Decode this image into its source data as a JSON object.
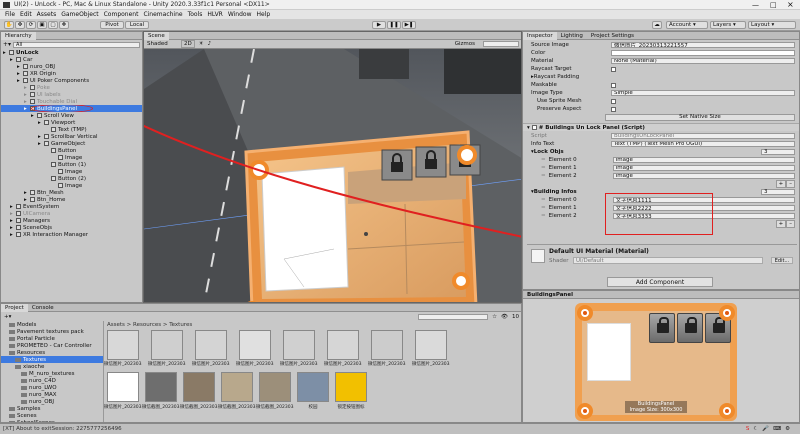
{
  "window": {
    "title": "UI(2) - UnLock - PC, Mac & Linux Standalone - Unity 2020.3.33f1c1 Personal <DX11>"
  },
  "menu": [
    "File",
    "Edit",
    "Assets",
    "GameObject",
    "Component",
    "Cinemachine",
    "Tools",
    "HLVR",
    "Window",
    "Help"
  ],
  "toolbar": {
    "pivot": "Pivot",
    "local": "Local",
    "account": "Account",
    "layers": "Layers",
    "layout": "Layout"
  },
  "hierarchy": {
    "tab": "Hierarchy",
    "search": "All",
    "items": [
      {
        "label": "UnLock",
        "indent": 0,
        "bold": true
      },
      {
        "label": "Car",
        "indent": 1
      },
      {
        "label": "nuro_OBJ",
        "indent": 2
      },
      {
        "label": "XR Origin",
        "indent": 2
      },
      {
        "label": "UI Poker Components",
        "indent": 2
      },
      {
        "label": "Poke",
        "indent": 3,
        "dim": true
      },
      {
        "label": "UI labels",
        "indent": 3,
        "dim": true
      },
      {
        "label": "Touchable Dial",
        "indent": 3,
        "dim": true
      },
      {
        "label": "BuildingsPanel",
        "indent": 3,
        "selected": true
      },
      {
        "label": "Scroll View",
        "indent": 4
      },
      {
        "label": "Viewport",
        "indent": 5
      },
      {
        "label": "Text (TMP)",
        "indent": 6
      },
      {
        "label": "Scrollbar Vertical",
        "indent": 5
      },
      {
        "label": "GameObject",
        "indent": 5
      },
      {
        "label": "Button",
        "indent": 6
      },
      {
        "label": "Image",
        "indent": 7
      },
      {
        "label": "Button (1)",
        "indent": 6
      },
      {
        "label": "Image",
        "indent": 7
      },
      {
        "label": "Button (2)",
        "indent": 6
      },
      {
        "label": "Image",
        "indent": 7
      },
      {
        "label": "Btn_Mesh",
        "indent": 3
      },
      {
        "label": "Btn_Home",
        "indent": 3
      },
      {
        "label": "EventSystem",
        "indent": 1
      },
      {
        "label": "UICamera",
        "indent": 1,
        "dim": true
      },
      {
        "label": "Managers",
        "indent": 1
      },
      {
        "label": "SceneObjs",
        "indent": 1
      },
      {
        "label": "XR Interaction Manager",
        "indent": 1
      }
    ]
  },
  "scene": {
    "tab": "Scene",
    "shading": "Shaded",
    "mode": "2D",
    "gizmos": "Gizmos"
  },
  "inspector": {
    "tabs": [
      "Inspector",
      "Lighting",
      "Project Settings"
    ],
    "image_fields": [
      {
        "label": "Source Image",
        "value": "微信图片_20230313221557"
      },
      {
        "label": "Color",
        "value": ""
      },
      {
        "label": "Material",
        "value": "None (Material)"
      }
    ],
    "raycast_target": "Raycast Target",
    "raycast_padding": "Raycast Padding",
    "maskable": "Maskable",
    "image_type_label": "Image Type",
    "image_type": "Simple",
    "use_sprite_mesh": "Use Sprite Mesh",
    "preserve_aspect": "Preserve Aspect",
    "set_native_size": "Set Native Size",
    "script_title": "Buildings Un Lock Panel (Script)",
    "script_label": "Script",
    "script_value": "BuildingsUnLockPanel",
    "info_text_label": "Info Text",
    "info_text_value": "Text (TMP) (Text Mesh Pro UGUI)",
    "lock_objs_label": "Lock Objs",
    "lock_objs_count": "3",
    "lock_objs": [
      {
        "label": "Element 0",
        "value": "Image"
      },
      {
        "label": "Element 1",
        "value": "Image"
      },
      {
        "label": "Element 2",
        "value": "Image"
      }
    ],
    "building_infos_label": "Building Infos",
    "building_infos_count": "3",
    "building_infos": [
      {
        "label": "Element 0",
        "value": "文字信息1111"
      },
      {
        "label": "Element 1",
        "value": "文字信息2222"
      },
      {
        "label": "Element 2",
        "value": "文字信息3333"
      }
    ],
    "material_title": "Default UI Material (Material)",
    "shader_label": "Shader",
    "shader_value": "UI/Default",
    "edit_label": "Edit...",
    "add_component": "Add Component",
    "preview_label": "BuildingsPanel",
    "preview_caption": "BuildingsPanel",
    "preview_size": "Image Size: 300x300"
  },
  "project": {
    "tabs": [
      "Project",
      "Console"
    ],
    "breadcrumb": "Assets > Resources > Textures",
    "count": "10",
    "tree": [
      {
        "label": "Models",
        "indent": 1
      },
      {
        "label": "Pavement textures pack",
        "indent": 1
      },
      {
        "label": "Portal Particle",
        "indent": 1
      },
      {
        "label": "PROMETEO - Car Controller",
        "indent": 1
      },
      {
        "label": "Resources",
        "indent": 1
      },
      {
        "label": "Textures",
        "indent": 2,
        "selected": true
      },
      {
        "label": "xiaoche",
        "indent": 2
      },
      {
        "label": "M_nuro_textures",
        "indent": 3
      },
      {
        "label": "nuro_C4D",
        "indent": 3
      },
      {
        "label": "nuro_LWO",
        "indent": 3
      },
      {
        "label": "nuro_MAX",
        "indent": 3
      },
      {
        "label": "nuro_OBJ",
        "indent": 3
      },
      {
        "label": "Samples",
        "indent": 1
      },
      {
        "label": "Scenes",
        "indent": 1
      },
      {
        "label": "SchoolScenes",
        "indent": 1
      }
    ],
    "thumbs_top": [
      "微信图片_202303...",
      "微信图片_202303...",
      "微信图片_202303...",
      "微信图片_202303...",
      "微信图片_202303...",
      "微信图片_202303...",
      "微信图片_202303...",
      "微信图片_202303..."
    ],
    "thumbs_bottom": [
      "微信图片_202303...",
      "微信截图_202303...",
      "微信截图_202303...",
      "微信截图_202303...",
      "微信截图_202303...",
      "校园",
      "锁定按钮图标"
    ]
  },
  "status": {
    "text": "[XT] About to exitSession: 2275777256496"
  },
  "colors": {
    "orange": "#f08a2a",
    "selection": "#3d7ae0",
    "annotation": "#e02020"
  }
}
